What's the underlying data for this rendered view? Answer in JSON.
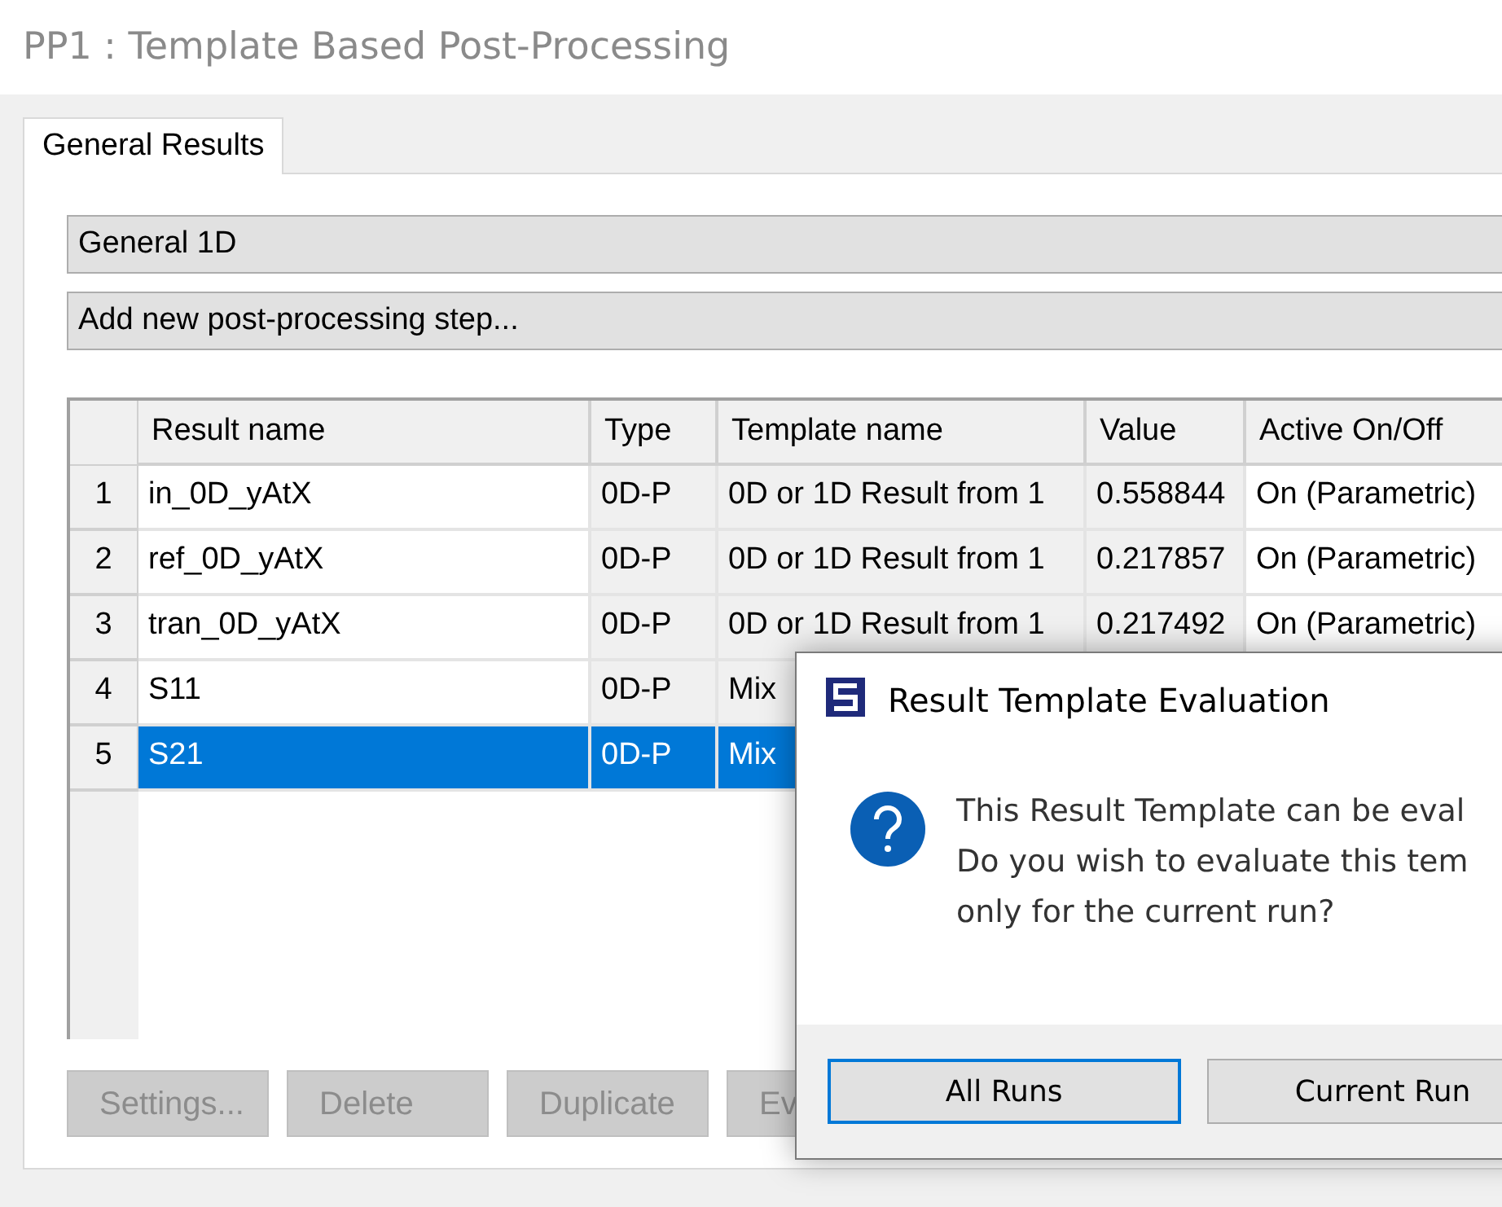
{
  "window": {
    "title": "PP1 : Template Based Post-Processing"
  },
  "tabs": [
    {
      "label": "General Results",
      "selected": true
    }
  ],
  "dropdowns": [
    {
      "value": "General 1D"
    },
    {
      "value": "Add new post-processing step..."
    }
  ],
  "table": {
    "columns": [
      "Result name",
      "Type",
      "Template name",
      "Value",
      "Active On/Off"
    ],
    "rows": [
      {
        "number": "1",
        "cells": [
          "in_0D_yAtX",
          "0D-P",
          "0D or 1D Result from 1",
          "0.558844",
          "On (Parametric)"
        ],
        "selected": false
      },
      {
        "number": "2",
        "cells": [
          "ref_0D_yAtX",
          "0D-P",
          "0D or 1D Result from 1",
          "0.217857",
          "On (Parametric)"
        ],
        "selected": false
      },
      {
        "number": "3",
        "cells": [
          "tran_0D_yAtX",
          "0D-P",
          "0D or 1D Result from 1",
          "0.217492",
          "On (Parametric)"
        ],
        "selected": false
      },
      {
        "number": "4",
        "cells": [
          "S11",
          "0D-P",
          "Mix"
        ],
        "selected": false
      },
      {
        "number": "5",
        "cells": [
          "S21",
          "0D-P",
          "Mix"
        ],
        "selected": true
      }
    ]
  },
  "buttons": [
    {
      "label": "Settings...",
      "disabled": true
    },
    {
      "label": "Delete",
      "disabled": true
    },
    {
      "label": "Duplicate",
      "disabled": true
    },
    {
      "label": "Ev",
      "disabled": true
    }
  ],
  "dialog": {
    "title": "Result Template Evaluation",
    "message_lines": [
      "This Result Template can be eval",
      "Do you wish to evaluate this tem",
      "only for the current run?"
    ],
    "buttons": [
      {
        "label": "All Runs",
        "focused": true
      },
      {
        "label": "Current Run",
        "focused": false
      }
    ]
  }
}
